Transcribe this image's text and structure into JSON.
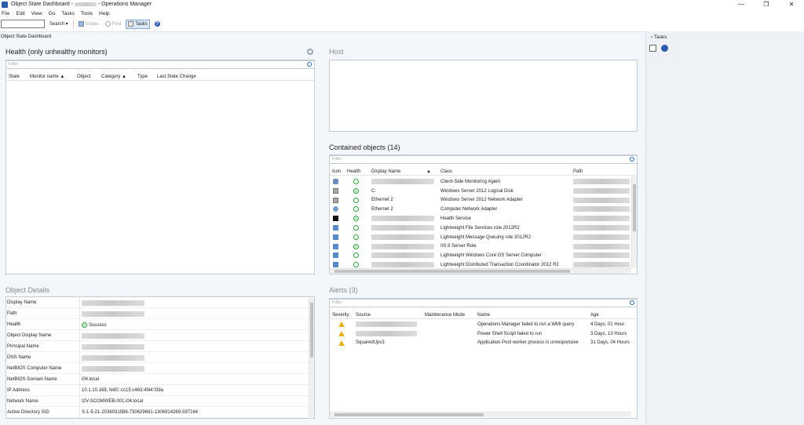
{
  "window": {
    "title_prefix": "Object State Dashboard - ",
    "title_suffix": " - Operations Manager",
    "controls": [
      "—",
      "❐",
      "✕"
    ]
  },
  "menu": [
    "File",
    "Edit",
    "View",
    "Go",
    "Tasks",
    "Tools",
    "Help"
  ],
  "toolbar": {
    "search_label": "Search ▾",
    "scope_label": "Scope",
    "find_label": "Find",
    "tasks_label": "Tasks",
    "help_label": "?"
  },
  "workspace_header": "Object State Dashboard",
  "health": {
    "title": "Health (only unhealthy monitors)",
    "filter_placeholder": "Filter",
    "columns": [
      "State",
      "Monitor name ▲",
      "Object",
      "Category ▲",
      "Type",
      "Last State Change"
    ]
  },
  "host": {
    "title": "Host"
  },
  "contained": {
    "title": "Contained objects (14)",
    "filter_placeholder": "Filter",
    "columns": [
      "Icon",
      "Health",
      "Display Name",
      "▲",
      "Class",
      "Path"
    ],
    "rows": [
      {
        "icon": "agent",
        "health": "ok",
        "name": "",
        "class": "Client-Side Monitoring Agent"
      },
      {
        "icon": "disk",
        "health": "check",
        "name": "C:",
        "class": "Windows Server 2012 Logical Disk"
      },
      {
        "icon": "disk",
        "health": "ok",
        "name": "Ethernet 2",
        "class": "Windows Server 2012 Network Adapter"
      },
      {
        "icon": "net",
        "health": "ok",
        "name": "Ethernet 2",
        "class": "Computer Network Adapter"
      },
      {
        "icon": "svc",
        "health": "check",
        "name": "",
        "class": "Health Service"
      },
      {
        "icon": "role",
        "health": "ok",
        "name": "",
        "class": "Lightweight File Services role 2012R2"
      },
      {
        "icon": "role",
        "health": "ok",
        "name": "",
        "class": "Lightweight Message Queuing role 2012R2"
      },
      {
        "icon": "role",
        "health": "check",
        "name": "",
        "class": "IIS 8 Server Role"
      },
      {
        "icon": "role",
        "health": "ok",
        "name": "",
        "class": "Lightweight Windows Core OS Server Computer"
      },
      {
        "icon": "role",
        "health": "ok",
        "name": "",
        "class": "Lightweight Distributed Transaction Coordinator 2012 R2"
      }
    ]
  },
  "details": {
    "title": "Object Details",
    "rows": [
      {
        "key": "Display Name",
        "value": ""
      },
      {
        "key": "Path",
        "value": ""
      },
      {
        "key": "Health",
        "value": "Success"
      },
      {
        "key": "Object Display Name",
        "value": ""
      },
      {
        "key": "Principal Name",
        "value": ""
      },
      {
        "key": "DNS Name",
        "value": ""
      },
      {
        "key": "NetBIOS Computer Name",
        "value": ""
      },
      {
        "key": "NetBIOS Domain Name",
        "value": "i04.local"
      },
      {
        "key": "IP Address",
        "value": "10.1.10.168, fe80::cc15:c463:4f44:f39a"
      },
      {
        "key": "Network Name",
        "value": "I2V-SCOMWEB-001.i04.local"
      },
      {
        "key": "Active Directory SID",
        "value": "S-1-5-21-2036031588-730629661-1306914269-597164"
      }
    ]
  },
  "alerts": {
    "title": "Alerts (3)",
    "filter_placeholder": "Filter",
    "columns": [
      "Severity",
      "Source",
      "Maintenance Mode",
      "Name",
      "Age"
    ],
    "rows": [
      {
        "source": "",
        "name": "Operations Manager failed to run a WMI query",
        "age": "4 Days, 01 Hour"
      },
      {
        "source": "",
        "name": "Power Shell Script failed to run",
        "age": "3 Days, 13 Hours"
      },
      {
        "source": "SquaredUpv3",
        "name": "Application Pool worker process is unresponsive",
        "age": "31 Days, 04 Hours"
      }
    ]
  },
  "tasks_pane": {
    "title": "Tasks"
  }
}
